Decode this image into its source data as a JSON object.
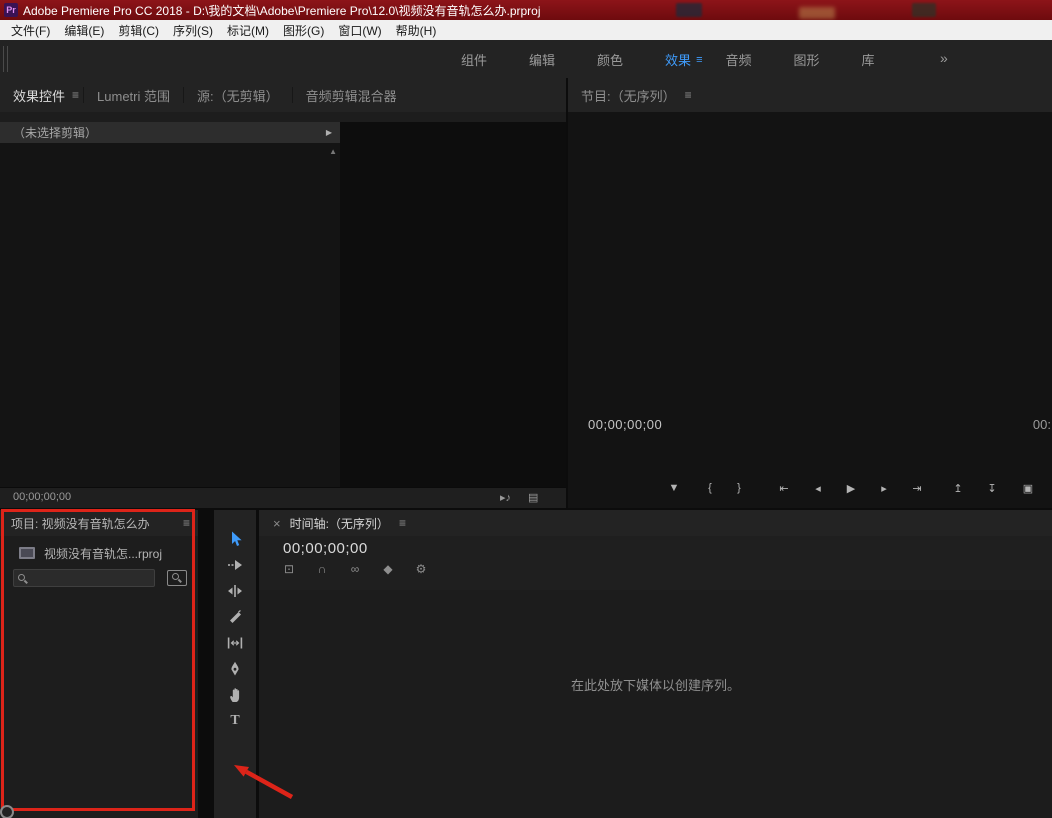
{
  "colors": {
    "accent_blue": "#3f9bfa",
    "annotation_red": "#dd2419",
    "titlebar_red": "#7c0f12"
  },
  "title_bar": {
    "app_badge": "Pr",
    "title": "Adobe Premiere Pro CC 2018 - D:\\我的文档\\Adobe\\Premiere Pro\\12.0\\视频没有音轨怎么办.prproj"
  },
  "menu_bar": [
    "文件(F)",
    "编辑(E)",
    "剪辑(C)",
    "序列(S)",
    "标记(M)",
    "图形(G)",
    "窗口(W)",
    "帮助(H)"
  ],
  "workspace_bar": {
    "tabs": [
      "组件",
      "编辑",
      "颜色",
      "效果",
      "音频",
      "图形",
      "库"
    ],
    "active_tab": "效果",
    "panel_menu_icon": "≡",
    "overflow_icon": "»"
  },
  "left_monitor": {
    "tabs": [
      "效果控件",
      "Lumetri 范围",
      "源:（无剪辑）",
      "音频剪辑混合器"
    ],
    "active_tab": "效果控件",
    "panel_menu_icon": "≡",
    "clip_selector_label": "（未选择剪辑）",
    "expand_icon": "▶",
    "scroll_up_icon": "▲",
    "timecode": "00;00;00;00",
    "footer_icons": [
      {
        "name": "play-audio-icon",
        "glyph": "▸♪"
      },
      {
        "name": "export-frame-icon",
        "glyph": "▤"
      }
    ]
  },
  "program_monitor": {
    "tab": "节目:（无序列）",
    "panel_menu_icon": "≡",
    "timecode": "00;00;00;00",
    "duration": "00:",
    "transport": [
      {
        "name": "add-marker-icon",
        "glyph": "▼"
      },
      {
        "name": "mark-in-icon",
        "glyph": "{"
      },
      {
        "name": "mark-out-icon",
        "glyph": "}"
      },
      {
        "name": "go-to-in-icon",
        "glyph": "⇤"
      },
      {
        "name": "step-back-icon",
        "glyph": "◂"
      },
      {
        "name": "play-icon",
        "glyph": "▶"
      },
      {
        "name": "step-forward-icon",
        "glyph": "▸"
      },
      {
        "name": "go-to-out-icon",
        "glyph": "⇥"
      },
      {
        "name": "lift-icon",
        "glyph": "↥"
      },
      {
        "name": "extract-icon",
        "glyph": "↧"
      },
      {
        "name": "export-frame-icon",
        "glyph": "▣"
      }
    ]
  },
  "project_panel": {
    "title": "项目: 视频没有音轨怎么办",
    "panel_menu_icon": "≡",
    "item_label": "视频没有音轨怎...rproj",
    "search_value": ""
  },
  "tools": {
    "items": [
      "selection-tool",
      "track-select-forward-tool",
      "ripple-edit-tool",
      "razor-tool",
      "slip-tool",
      "pen-tool",
      "hand-tool",
      "type-tool"
    ],
    "active_tool": "selection-tool",
    "type_tool_glyph": "T"
  },
  "timeline_panel": {
    "close_icon": "×",
    "tab": "时间轴:（无序列）",
    "panel_menu_icon": "≡",
    "timecode": "00;00;00;00",
    "toolbar": [
      {
        "name": "nest-sequence-icon",
        "glyph": "⊡"
      },
      {
        "name": "snap-icon",
        "glyph": "∩"
      },
      {
        "name": "linked-selection-icon",
        "glyph": "∞"
      },
      {
        "name": "add-marker-icon",
        "glyph": "◆"
      },
      {
        "name": "timeline-settings-icon",
        "glyph": "⚙"
      }
    ],
    "empty_message": "在此处放下媒体以创建序列。"
  }
}
